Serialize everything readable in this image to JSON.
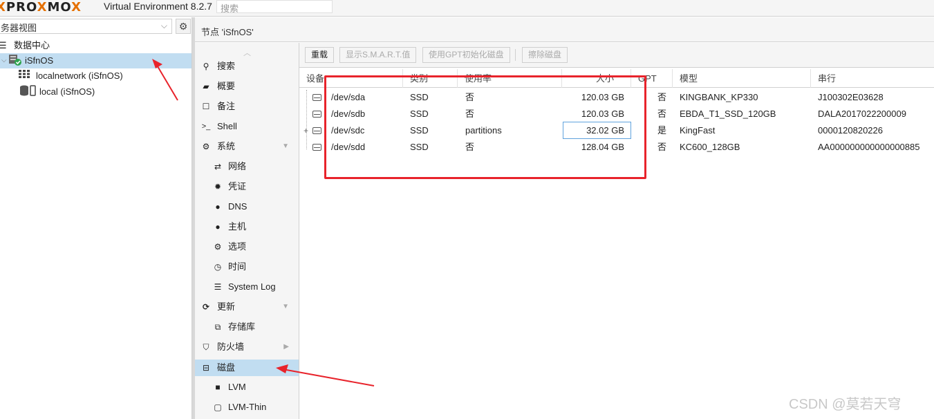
{
  "topbar": {
    "logo_left": "PRO",
    "logo_x1": "X",
    "logo_mid": "MO",
    "logo_x2": "X",
    "version": "Virtual Environment 8.2.7",
    "search_placeholder": "搜索"
  },
  "left_panel": {
    "view_selector": "务器视图",
    "tree": [
      {
        "label": "数据中心",
        "icon": "datacenter-icon"
      },
      {
        "label": "iSfnOS",
        "icon": "node-online-icon",
        "selected": true
      },
      {
        "label": "localnetwork (iSfnOS)",
        "icon": "network-grid-icon"
      },
      {
        "label": "local (iSfnOS)",
        "icon": "storage-icon"
      }
    ]
  },
  "main": {
    "title": "节点 'iSfnOS'"
  },
  "nav": {
    "items": [
      {
        "label": "搜索",
        "icon": "search-icon"
      },
      {
        "label": "概要",
        "icon": "summary-icon"
      },
      {
        "label": "备注",
        "icon": "notes-icon"
      },
      {
        "label": "Shell",
        "icon": "terminal-icon"
      },
      {
        "label": "系统",
        "icon": "cogs-icon"
      },
      {
        "label": "网络",
        "icon": "exchange-icon"
      },
      {
        "label": "凭证",
        "icon": "certificate-icon"
      },
      {
        "label": "DNS",
        "icon": "globe-icon"
      },
      {
        "label": "主机",
        "icon": "globe-icon"
      },
      {
        "label": "选项",
        "icon": "gear-icon"
      },
      {
        "label": "时间",
        "icon": "clock-icon"
      },
      {
        "label": "System Log",
        "icon": "list-icon"
      },
      {
        "label": "更新",
        "icon": "refresh-icon"
      },
      {
        "label": "存储库",
        "icon": "files-icon"
      },
      {
        "label": "防火墙",
        "icon": "shield-icon"
      },
      {
        "label": "磁盘",
        "icon": "hdd-icon"
      },
      {
        "label": "LVM",
        "icon": "square-icon"
      },
      {
        "label": "LVM-Thin",
        "icon": "square-outline-icon"
      }
    ]
  },
  "toolbar": {
    "reload": "重载",
    "smart": "显示S.M.A.R.T.值",
    "gpt_init": "使用GPT初始化磁盘",
    "wipe": "擦除磁盘"
  },
  "grid": {
    "columns": [
      "设备",
      "类别",
      "使用率",
      "大小",
      "GPT",
      "模型",
      "串行"
    ],
    "rows": [
      {
        "device": "/dev/sda",
        "type": "SSD",
        "usage": "否",
        "size": "120.03 GB",
        "gpt": "否",
        "model": "KINGBANK_KP330",
        "serial": "J100302E03628"
      },
      {
        "device": "/dev/sdb",
        "type": "SSD",
        "usage": "否",
        "size": "120.03 GB",
        "gpt": "否",
        "model": "EBDA_T1_SSD_120GB",
        "serial": "DALA2017022200009"
      },
      {
        "device": "/dev/sdc",
        "type": "SSD",
        "usage": "partitions",
        "size": "32.02 GB",
        "gpt": "是",
        "model": "KingFast",
        "serial": "0000120820226",
        "expandable": "+"
      },
      {
        "device": "/dev/sdd",
        "type": "SSD",
        "usage": "否",
        "size": "128.04 GB",
        "gpt": "否",
        "model": "KC600_128GB",
        "serial": "AA000000000000000885"
      }
    ]
  },
  "watermark": "CSDN @莫若天穹",
  "colors": {
    "selection": "#c1ddf1",
    "accent_orange": "#e57000",
    "annotation_red": "#e8232b"
  }
}
